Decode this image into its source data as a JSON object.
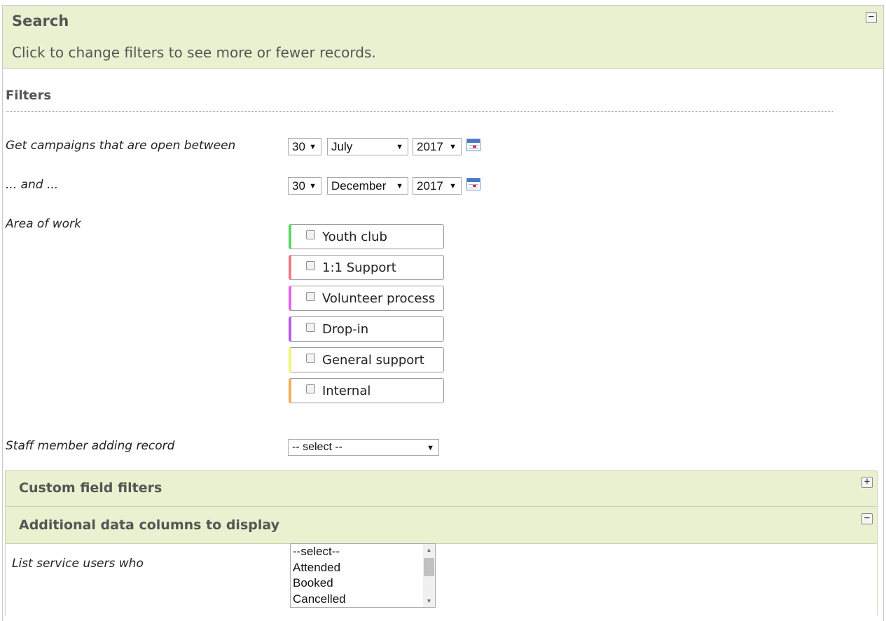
{
  "search": {
    "title": "Search",
    "subtitle": "Click to change filters to see more or fewer records.",
    "collapse_label": "−"
  },
  "filters": {
    "title": "Filters",
    "open_between_label": "Get campaigns that are open between",
    "and_label": "... and ...",
    "from": {
      "day": "30",
      "month": "July",
      "year": "2017"
    },
    "to": {
      "day": "30",
      "month": "December",
      "year": "2017"
    },
    "area_label": "Area of work",
    "areas": [
      {
        "label": "Youth club",
        "color": "#5ad66a",
        "checked": false
      },
      {
        "label": "1:1 Support",
        "color": "#f07b88",
        "checked": false
      },
      {
        "label": "Volunteer process",
        "color": "#e067e8",
        "checked": false
      },
      {
        "label": "Drop-in",
        "color": "#b85ce8",
        "checked": false
      },
      {
        "label": "General support",
        "color": "#eef57a",
        "checked": false
      },
      {
        "label": "Internal",
        "color": "#f0b05c",
        "checked": false
      }
    ],
    "staff_label": "Staff member adding record",
    "staff_value": "-- select --"
  },
  "custom_filters": {
    "title": "Custom field filters",
    "expand_label": "+"
  },
  "additional": {
    "title": "Additional data columns to display",
    "collapse_label": "−",
    "list_label": "List service users who",
    "options": [
      "--select--",
      "Attended",
      "Booked",
      "Cancelled"
    ]
  },
  "colors": {
    "header_bg": "#e9f1d0",
    "accent_border": "#c9d3b0"
  }
}
